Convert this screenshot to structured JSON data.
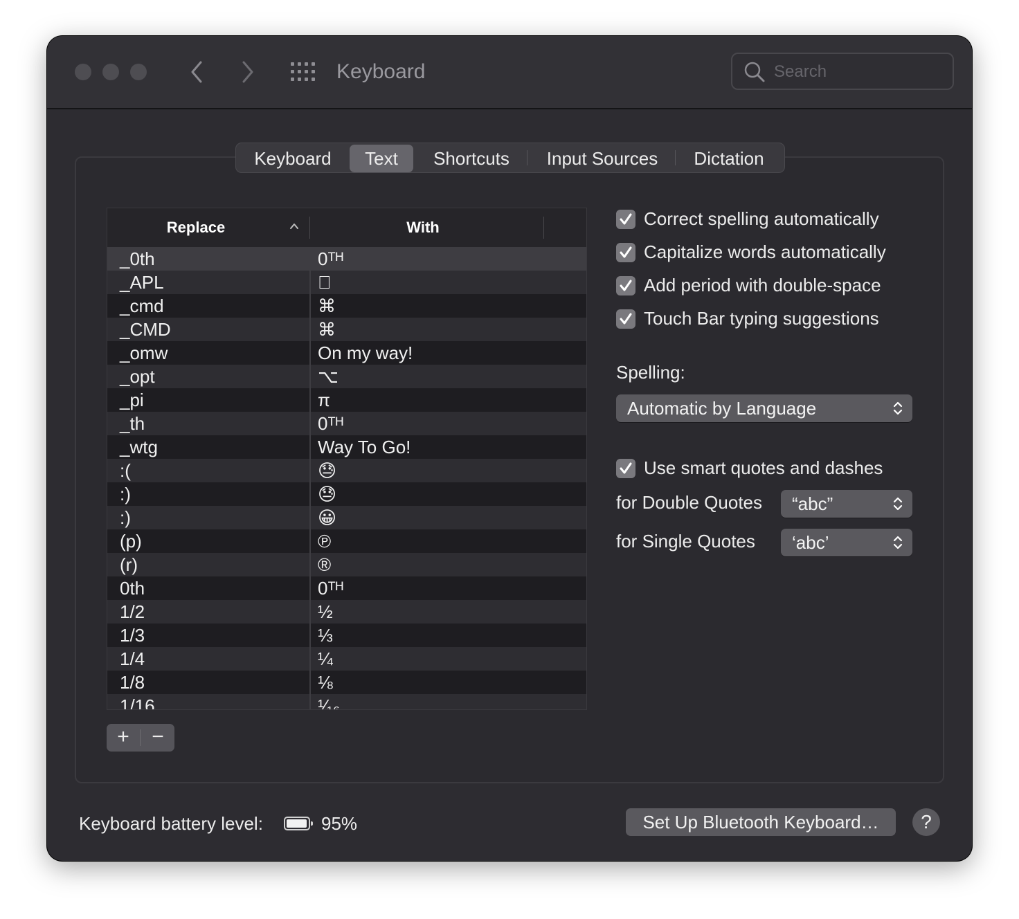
{
  "window": {
    "title": "Keyboard",
    "search_placeholder": "Search"
  },
  "tabs": [
    {
      "label": "Keyboard"
    },
    {
      "label": "Text"
    },
    {
      "label": "Shortcuts"
    },
    {
      "label": "Input Sources"
    },
    {
      "label": "Dictation"
    }
  ],
  "table": {
    "col_replace": "Replace",
    "col_with": "With",
    "rows": [
      {
        "replace": "_0th",
        "with": "0ᵀᴴ"
      },
      {
        "replace": "_APL",
        "with": ""
      },
      {
        "replace": "_cmd",
        "with": "⌘"
      },
      {
        "replace": "_CMD",
        "with": "⌘"
      },
      {
        "replace": "_omw",
        "with": "On my way!"
      },
      {
        "replace": "_opt",
        "with": "⌥"
      },
      {
        "replace": "_pi",
        "with": "π"
      },
      {
        "replace": "_th",
        "with": "0ᵀᴴ"
      },
      {
        "replace": "_wtg",
        "with": "Way To Go!"
      },
      {
        "replace": ":(",
        "with": "😓"
      },
      {
        "replace": ":)",
        "with": "😓"
      },
      {
        "replace": ":)",
        "with": "😀"
      },
      {
        "replace": "(p)",
        "with": "℗"
      },
      {
        "replace": "(r)",
        "with": "®"
      },
      {
        "replace": "0th",
        "with": "0ᵀᴴ"
      },
      {
        "replace": "1/2",
        "with": "½"
      },
      {
        "replace": "1/3",
        "with": "⅓"
      },
      {
        "replace": "1/4",
        "with": "¼"
      },
      {
        "replace": "1/8",
        "with": "⅛"
      },
      {
        "replace": "1/16",
        "with": "¹⁄₁₆"
      }
    ]
  },
  "buttons": {
    "add": "+",
    "remove": "−"
  },
  "options": {
    "correct_spelling": "Correct spelling automatically",
    "capitalize_words": "Capitalize words automatically",
    "add_period": "Add period with double-space",
    "touch_bar": "Touch Bar typing suggestions",
    "smart_quotes": "Use smart quotes and dashes"
  },
  "spelling": {
    "label": "Spelling:",
    "value": "Automatic by Language"
  },
  "quotes": {
    "double_label": "for Double Quotes",
    "double_value": "“abc”",
    "single_label": "for Single Quotes",
    "single_value": "‘abc’"
  },
  "footer": {
    "battery_label": "Keyboard battery level:",
    "battery_level": 0.95,
    "battery_pct": "95%",
    "bluetooth_button": "Set Up Bluetooth Keyboard…",
    "help": "?"
  },
  "colors": {
    "window_bg": "#2d2c31",
    "checkbox": "#7a797e",
    "control": "#5a595e"
  }
}
